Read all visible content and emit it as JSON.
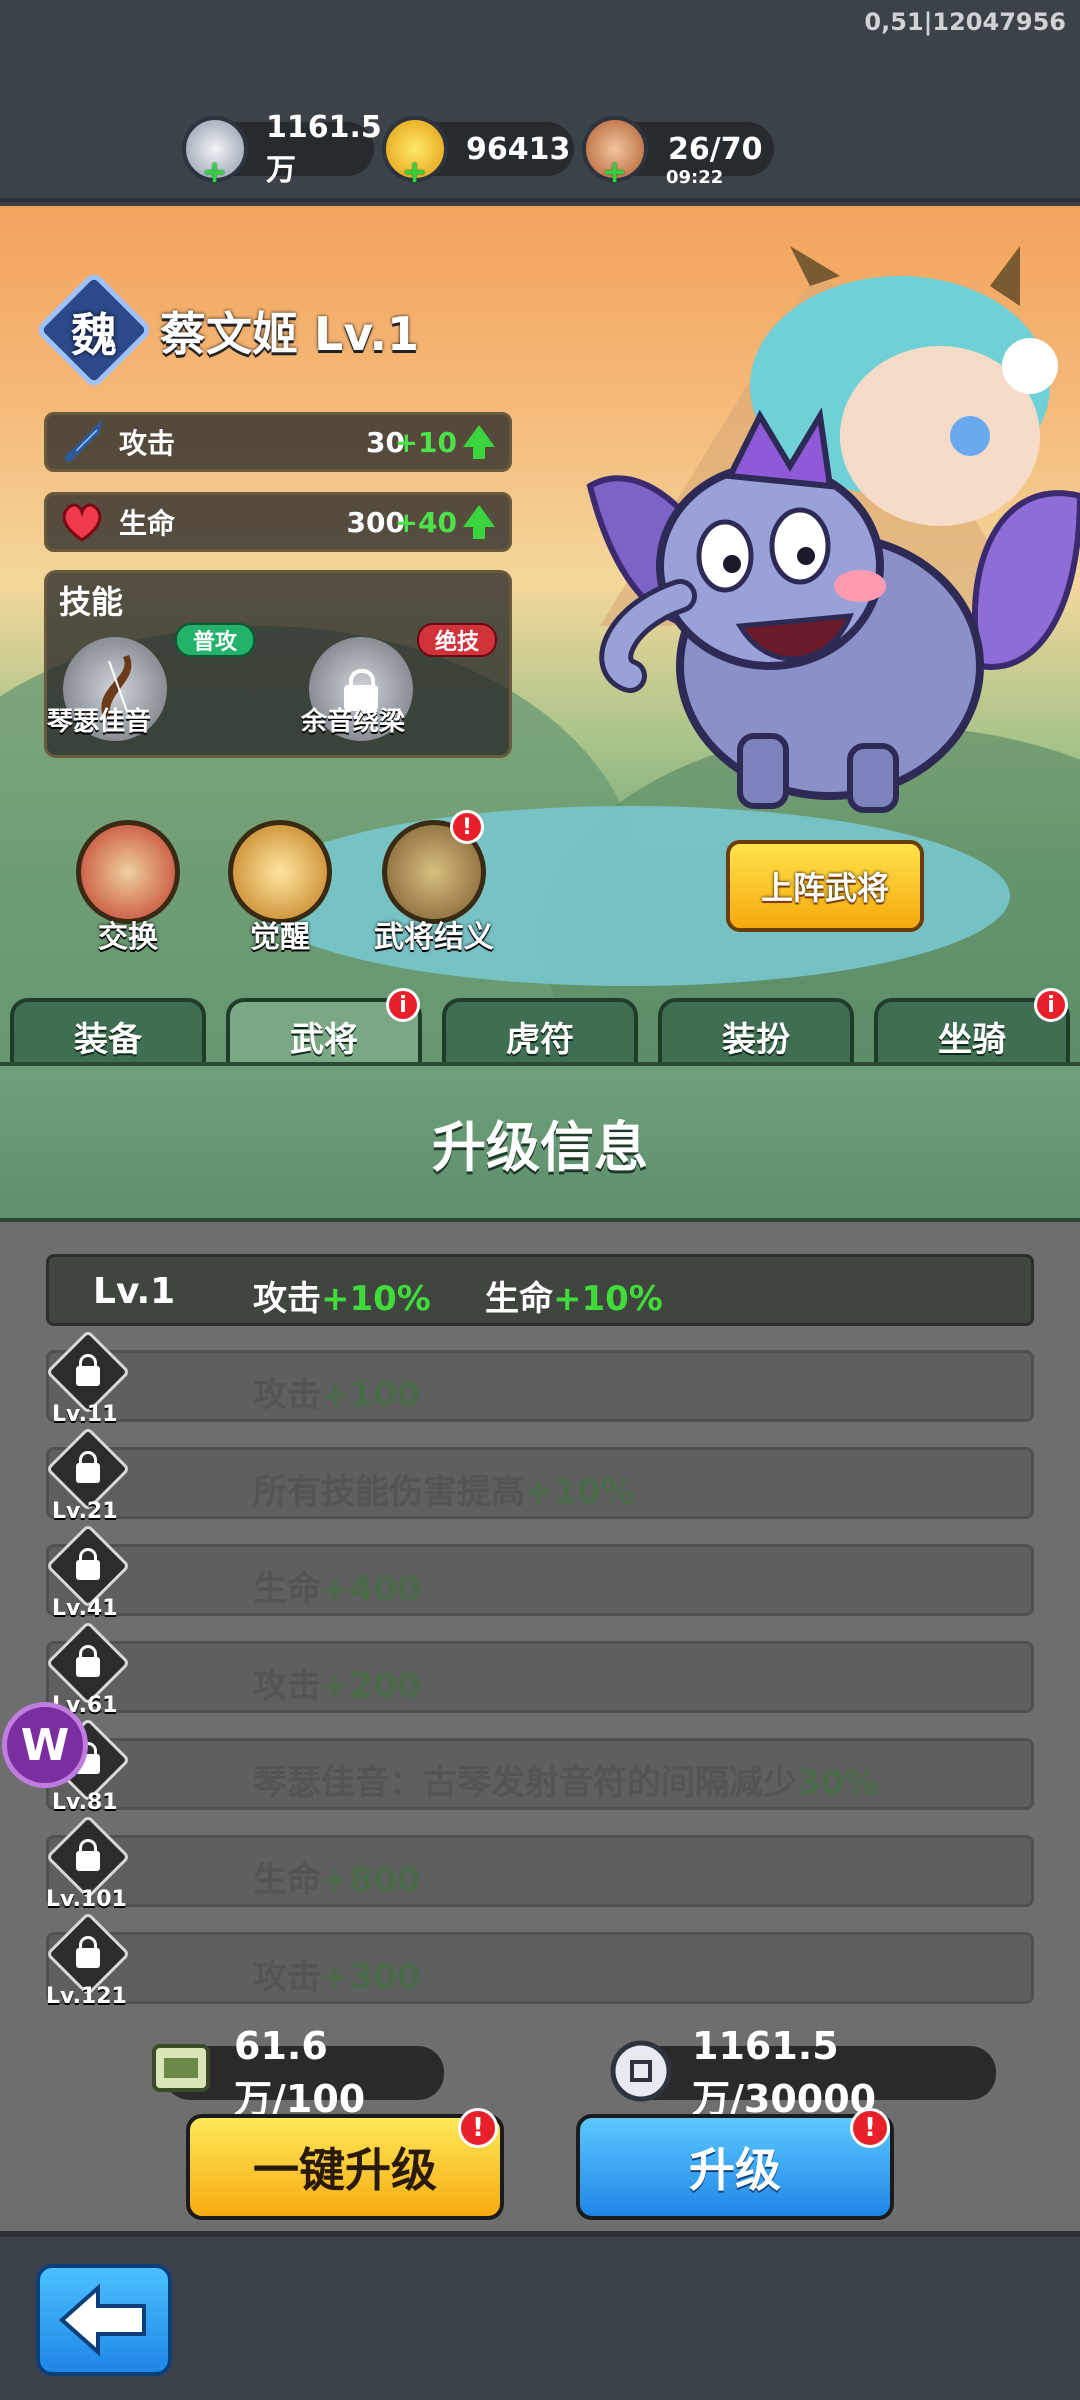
{
  "debug": "0,51|12047956",
  "resources": {
    "silver": "1161.5万",
    "gold": "96413",
    "stamina": "26/70",
    "stamina_timer": "09:22",
    "plus": "+"
  },
  "hero": {
    "faction": "魏",
    "name": "蔡文姬 Lv.1",
    "stats": [
      {
        "label": "攻击",
        "value": "30",
        "bonus": "+10"
      },
      {
        "label": "生命",
        "value": "300",
        "bonus": "+40"
      }
    ]
  },
  "skills": {
    "title": "技能",
    "items": [
      {
        "tag": "普攻",
        "name": "琴瑟佳音"
      },
      {
        "tag": "绝技",
        "name": "余音绕梁"
      }
    ]
  },
  "actions": [
    {
      "label": "交换"
    },
    {
      "label": "觉醒"
    },
    {
      "label": "武将结义",
      "badge": "!"
    }
  ],
  "deploy_label": "上阵武将",
  "tabs": [
    {
      "label": "装备"
    },
    {
      "label": "武将",
      "badge": "i"
    },
    {
      "label": "虎符"
    },
    {
      "label": "装扮"
    },
    {
      "label": "坐骑",
      "badge": "i"
    }
  ],
  "upgrade": {
    "title": "升级信息",
    "current": {
      "level": "Lv.1",
      "a_label": "攻击",
      "a_bonus": "+10%",
      "b_label": "生命",
      "b_bonus": "+10%"
    },
    "locked": [
      {
        "level": "Lv.11",
        "text": "攻击",
        "bonus": "+100"
      },
      {
        "level": "Lv.21",
        "text": "所有技能伤害提高",
        "bonus": "+10%"
      },
      {
        "level": "Lv.41",
        "text": "生命",
        "bonus": "+400"
      },
      {
        "level": "Lv.61",
        "text": "攻击",
        "bonus": "+200"
      },
      {
        "level": "Lv.81",
        "text": "琴瑟佳音：古琴发射音符的间隔减少",
        "bonus": "30%"
      },
      {
        "level": "Lv.101",
        "text": "生命",
        "bonus": "+800"
      },
      {
        "level": "Lv.121",
        "text": "攻击",
        "bonus": "+300"
      }
    ]
  },
  "costs": {
    "scroll": "61.6万/100",
    "silver": "1161.5万/30000"
  },
  "buttons": {
    "one_click": "一键升级",
    "upgrade": "升级",
    "badge": "!"
  },
  "logo_letter": "W",
  "colors": {
    "accent_green": "#3fdc3a",
    "tab_green": "#3f6e52",
    "yellow_button": "#f6a90e",
    "blue_button": "#1e86e6",
    "badge_red": "#e8202a"
  }
}
